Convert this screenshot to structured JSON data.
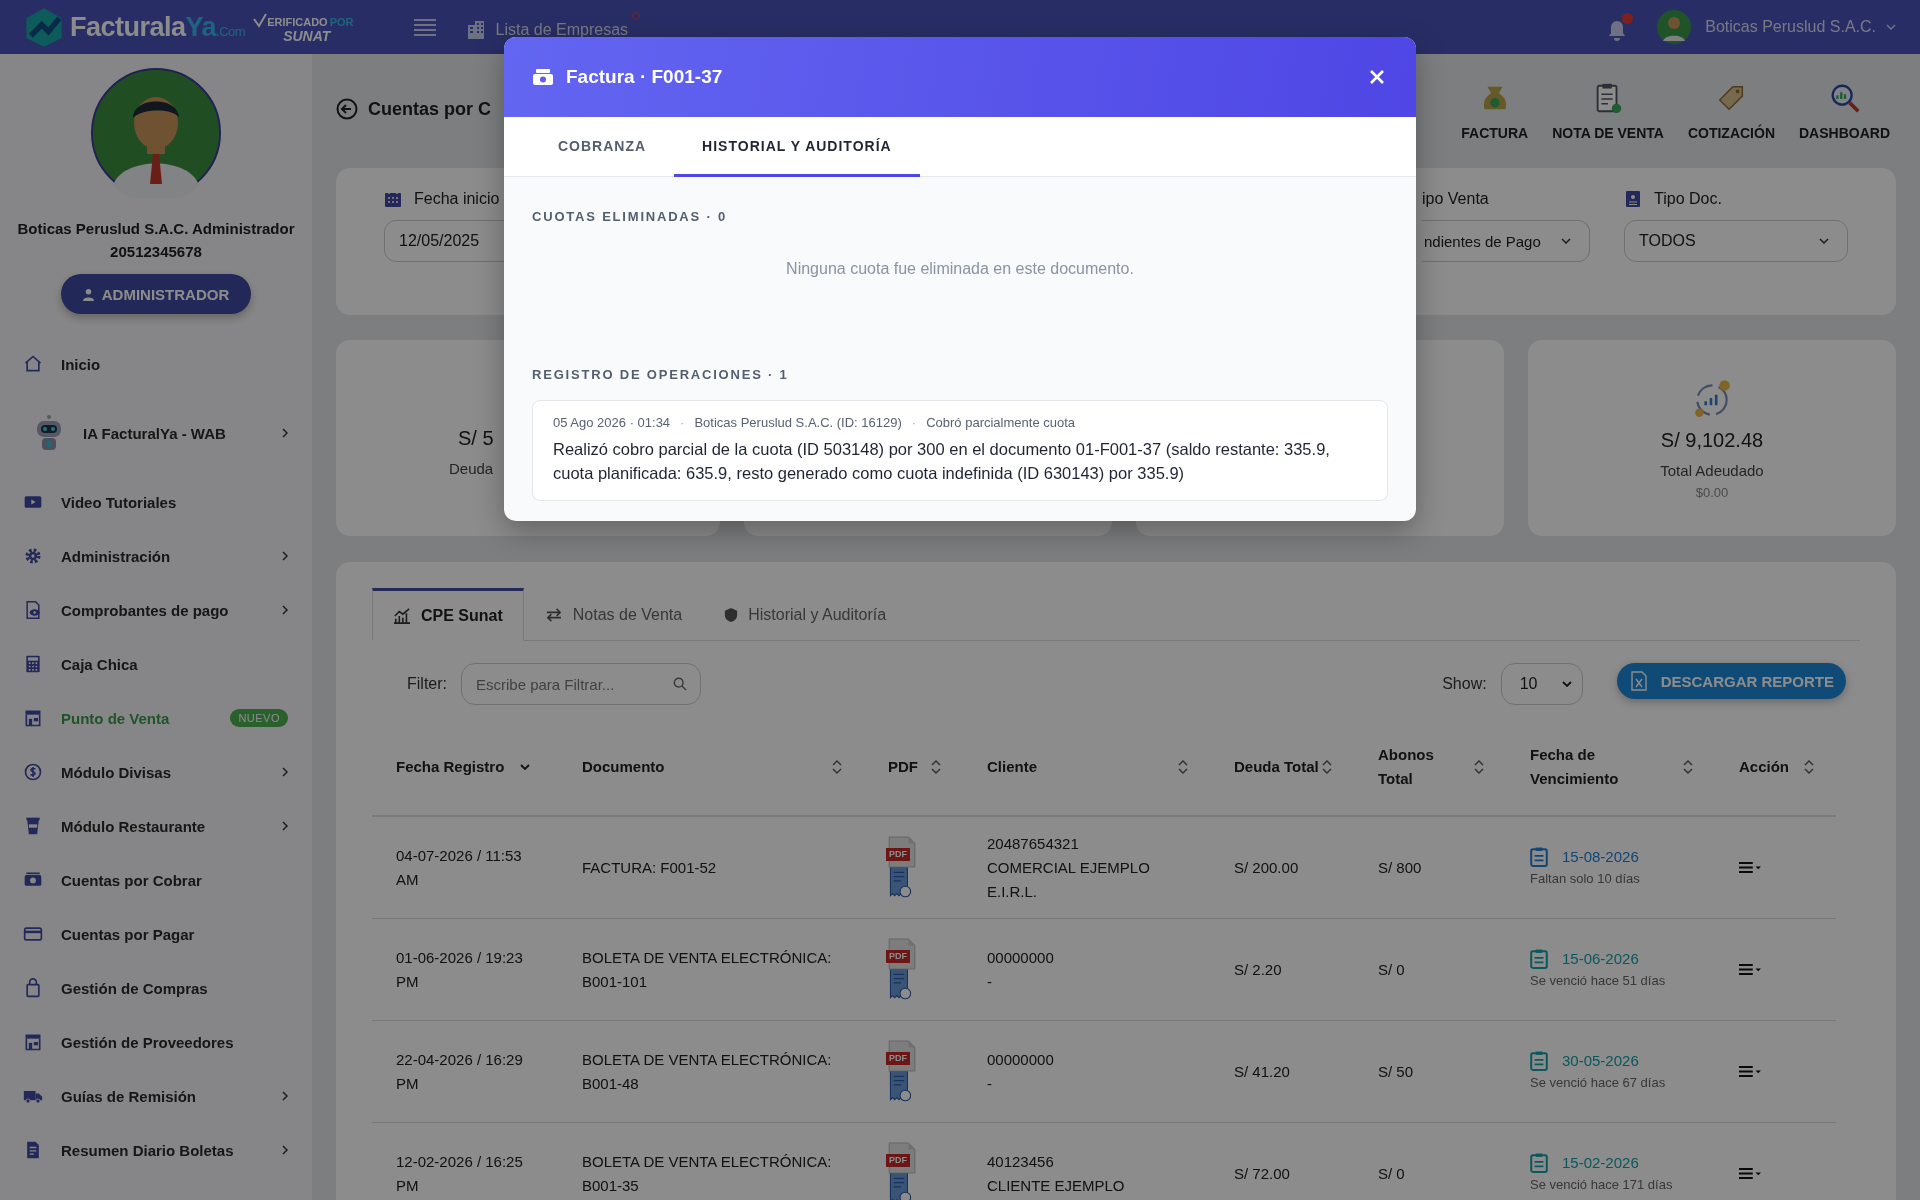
{
  "topbar": {
    "logo": {
      "brand": "Facturala",
      "accent": "Ya",
      "suffix": ".Com"
    },
    "verified": {
      "word": "ERIFICADO",
      "by": "POR",
      "authority": "SUNAT"
    },
    "companies_link": "Lista de Empresas",
    "companies_alert": true,
    "notifications_alert": true,
    "account": "Boticas Peruslud S.A.C."
  },
  "sidebar": {
    "user_name": "Boticas Peruslud S.A.C. Administrador",
    "ruc": "20512345678",
    "role_button": "ADMINISTRADOR",
    "items": [
      {
        "label": "Inicio",
        "expandable": false,
        "highlighted": false
      },
      {
        "label": "IA FacturalYa - WAB",
        "expandable": true,
        "highlighted": false
      },
      {
        "label": "Video Tutoriales",
        "expandable": false,
        "highlighted": false
      },
      {
        "label": "Administración",
        "expandable": true,
        "highlighted": false
      },
      {
        "label": "Comprobantes de pago",
        "expandable": true,
        "highlighted": false
      },
      {
        "label": "Caja Chica",
        "expandable": false,
        "highlighted": false
      },
      {
        "label": "Punto de Venta",
        "expandable": false,
        "highlighted": true,
        "badge": "NUEVO"
      },
      {
        "label": "Módulo Divisas",
        "expandable": true,
        "highlighted": false
      },
      {
        "label": "Módulo Restaurante",
        "expandable": true,
        "highlighted": false
      },
      {
        "label": "Cuentas por Cobrar",
        "expandable": false,
        "highlighted": false
      },
      {
        "label": "Cuentas por Pagar",
        "expandable": false,
        "highlighted": false
      },
      {
        "label": "Gestión de Compras",
        "expandable": false,
        "highlighted": false
      },
      {
        "label": "Gestión de Proveedores",
        "expandable": false,
        "highlighted": false
      },
      {
        "label": "Guías de Remisión",
        "expandable": true,
        "highlighted": false
      },
      {
        "label": "Resumen Diario Boletas",
        "expandable": true,
        "highlighted": false
      }
    ]
  },
  "page_title": "Cuentas por C",
  "shortcuts": [
    "FACTURA",
    "NOTA DE VENTA",
    "COTIZACIÓN",
    "DASHBOARD"
  ],
  "filters": [
    {
      "label": "Fecha inicio",
      "value": "12/05/2025",
      "kind": "date",
      "clipped": false
    },
    {
      "label": "ipo Venta",
      "value": "ndientes de Pago",
      "kind": "select",
      "clipped": true
    },
    {
      "label": "Tipo Doc.",
      "value": "TODOS",
      "kind": "select",
      "clipped": false
    }
  ],
  "summary_cards": [
    {
      "amount": "S/ 5",
      "label": "Deuda",
      "clipped": true
    },
    {
      "amount": "S/ 9,102.48",
      "label": "Total Adeudado",
      "sub": "$0.00",
      "clipped": false
    }
  ],
  "table_section": {
    "tabs": [
      {
        "label": "CPE Sunat",
        "selected": true
      },
      {
        "label": "Notas de Venta",
        "selected": false
      },
      {
        "label": "Historial y Auditoría",
        "selected": false
      }
    ],
    "filter_label": "Filter:",
    "filter_placeholder": "Escribe para Filtrar...",
    "show_label": "Show:",
    "show_value": "10",
    "download_button": "DESCARGAR REPORTE",
    "columns": [
      {
        "label": "Fecha Registro",
        "sorted": true
      },
      {
        "label": "Documento",
        "sorted": false
      },
      {
        "label": "PDF",
        "sorted": false
      },
      {
        "label": "Cliente",
        "sorted": false
      },
      {
        "label": "Deuda Total",
        "sorted": false
      },
      {
        "label": "Abonos Total",
        "sorted": false
      },
      {
        "label": "Fecha de Vencimiento",
        "sorted": false
      },
      {
        "label": "Acción",
        "sorted": false
      }
    ],
    "rows": [
      {
        "fecha": "04-07-2026 / 11:53 AM",
        "documento": "FACTURA: F001-52",
        "pdf": "PDF",
        "cliente_doc": "20487654321",
        "cliente_name": "COMERCIAL EJEMPLO E.I.R.L.",
        "deuda": "S/ 200.00",
        "abonos": "S/ 800",
        "vencimiento": "15-08-2026",
        "nota": "Faltan solo 10 días",
        "overdue": false
      },
      {
        "fecha": "01-06-2026 / 19:23 PM",
        "documento": "BOLETA DE VENTA ELECTRÓNICA: B001-101",
        "pdf": "PDF",
        "cliente_doc": "00000000",
        "cliente_name": "-",
        "deuda": "S/ 2.20",
        "abonos": "S/ 0",
        "vencimiento": "15-06-2026",
        "nota": "Se venció hace 51 días",
        "overdue": true
      },
      {
        "fecha": "22-04-2026 / 16:29 PM",
        "documento": "BOLETA DE VENTA ELECTRÓNICA: B001-48",
        "pdf": "PDF",
        "cliente_doc": "00000000",
        "cliente_name": "-",
        "deuda": "S/ 41.20",
        "abonos": "S/ 50",
        "vencimiento": "30-05-2026",
        "nota": "Se venció hace 67 días",
        "overdue": true
      },
      {
        "fecha": "12-02-2026 / 16:25 PM",
        "documento": "BOLETA DE VENTA ELECTRÓNICA: B001-35",
        "pdf": "PDF",
        "cliente_doc": "40123456",
        "cliente_name": "CLIENTE EJEMPLO",
        "deuda": "S/ 72.00",
        "abonos": "S/ 0",
        "vencimiento": "15-02-2026",
        "nota": "Se venció hace 171 días",
        "overdue": true
      }
    ]
  },
  "modal": {
    "title": "Factura · F001-37",
    "tabs": [
      {
        "label": "COBRANZA",
        "selected": false
      },
      {
        "label": "HISTORIAL Y AUDITORÍA",
        "selected": true
      }
    ],
    "deleted_heading": "CUOTAS ELIMINADAS · 0",
    "deleted_empty": "Ninguna cuota fue eliminada en este documento.",
    "log_heading": "REGISTRO DE OPERACIONES · 1",
    "meta_separator": "·",
    "log_entries": [
      {
        "meta": [
          "05 Ago 2026 · 01:34",
          "Boticas Peruslud S.A.C. (ID: 16129)",
          "Cobró parcialmente cuota"
        ],
        "text": "Realizó cobro parcial de la cuota (ID 503148) por 300 en el documento 01-F001-37 (saldo restante: 335.9, cuota planificada: 635.9, resto generado como cuota indefinida (ID 630143) por 335.9)"
      }
    ]
  }
}
